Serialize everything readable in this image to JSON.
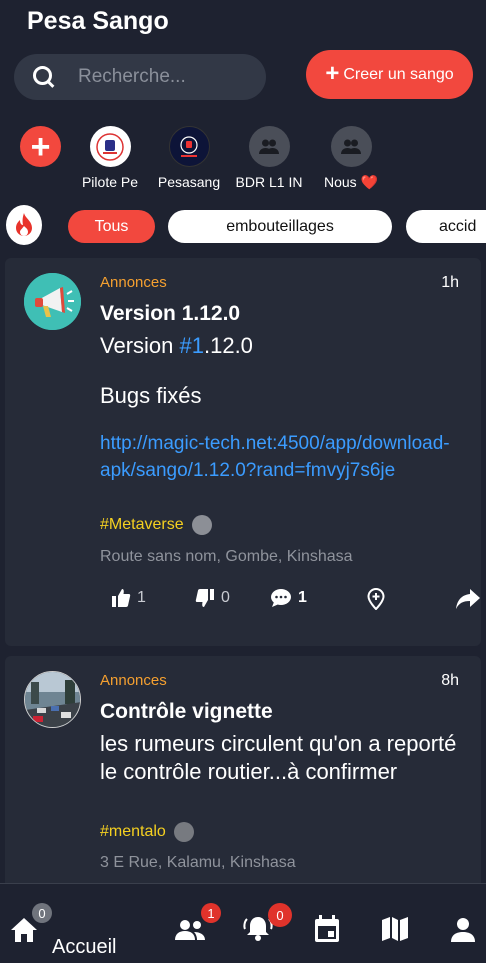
{
  "app": {
    "title": "Pesa Sango"
  },
  "search": {
    "placeholder": "Recherche..."
  },
  "create_button": {
    "label": "Creer un sango",
    "icon": "plus-icon"
  },
  "stories": [
    {
      "label": "Pilote Pe"
    },
    {
      "label": "Pesasang"
    },
    {
      "label": "BDR L1 IN"
    },
    {
      "label": "Nous ❤️"
    }
  ],
  "filters": {
    "icon": "fire-icon",
    "chips": [
      {
        "label": "Tous",
        "active": true
      },
      {
        "label": "embouteillages",
        "active": false
      },
      {
        "label": "accid",
        "active": false
      }
    ]
  },
  "posts": [
    {
      "category": "Annonces",
      "time": "1h",
      "title": "Version 1.12.0",
      "body_prefix": "Version ",
      "body_hashtag": "#1",
      "body_suffix": ".12.0",
      "body_2": "Bugs fixés",
      "link": "http://magic-tech.net:4500/app/download-apk/sango/1.12.0?rand=fmvyj7s6je",
      "tag": "#Metaverse",
      "location": "Route sans nom, Gombe, Kinshasa",
      "likes": "1",
      "dislikes": "0",
      "comments": "1"
    },
    {
      "category": "Annonces",
      "time": "8h",
      "title": "Contrôle vignette",
      "body": "les rumeurs circulent qu'on a reporté le contrôle routier...à confirmer",
      "tag": "#mentalo",
      "location": "3 E Rue, Kalamu, Kinshasa"
    }
  ],
  "bottom_nav": {
    "home_label": "Accueil",
    "home_badge": "0",
    "groups_badge": "1",
    "notifications_badge": "0"
  },
  "colors": {
    "accent": "#f2483e",
    "background": "#1e2230",
    "card": "#262b38",
    "link": "#3b9cff",
    "category": "#f5a030",
    "tag": "#f5d020"
  }
}
